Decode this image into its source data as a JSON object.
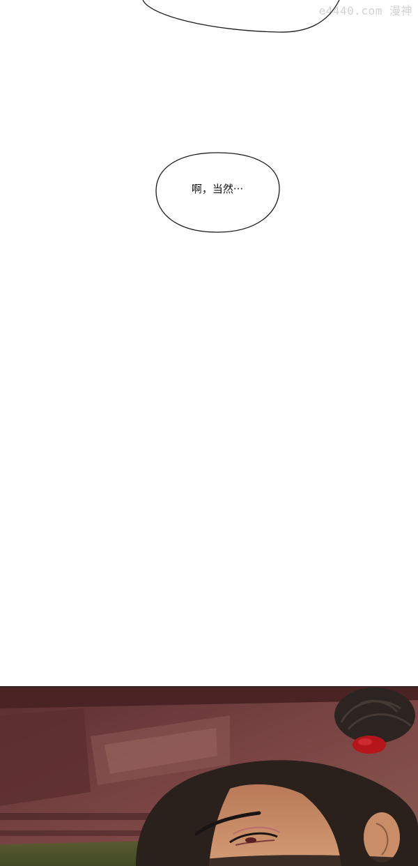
{
  "watermark": {
    "text": "e4440.com 漫神"
  },
  "speech_bubble": {
    "text": "啊，当然···"
  },
  "colors": {
    "page_background": "#ffffff",
    "bubble_outline": "#1a1a1a",
    "panel_wall": "#6a3a38",
    "hair": "#2a211d",
    "skin": "#c98d67",
    "hair_tie": "#b5161b"
  },
  "panel": {
    "subject": "dark-haired character with topknot and red hair tie, eyes narrowed"
  }
}
